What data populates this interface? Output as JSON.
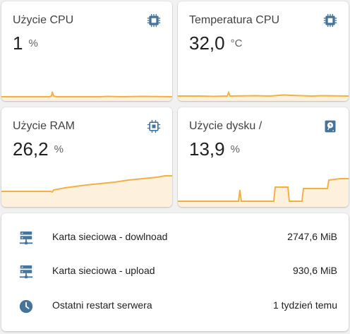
{
  "colors": {
    "icon": "#44739e",
    "line": "#f4b043",
    "fill": "#fdf0dd",
    "card": "#ffffff",
    "background": "#f1f1f1"
  },
  "sensors": {
    "cpu": {
      "title": "Użycie CPU",
      "value": "1",
      "unit": "%",
      "icon": "cpu-chip-icon"
    },
    "temp": {
      "title": "Temperatura CPU",
      "value": "32,0",
      "unit": "°C",
      "icon": "cpu-chip-icon"
    },
    "ram": {
      "title": "Użycie RAM",
      "value": "26,2",
      "unit": "%",
      "icon": "memory-chip-icon"
    },
    "disk": {
      "title": "Użycie dysku /",
      "value": "13,9",
      "unit": "%",
      "icon": "hard-disk-icon"
    }
  },
  "entities": {
    "download": {
      "label": "Karta sieciowa - dowlnoad",
      "value": "2747,6 MiB",
      "icon": "server-network-icon"
    },
    "upload": {
      "label": "Karta sieciowa - upload",
      "value": "930,6 MiB",
      "icon": "server-network-icon"
    },
    "restart": {
      "label": "Ostatni restart serwera",
      "value": "1 tydzień temu",
      "icon": "clock-icon"
    }
  }
}
